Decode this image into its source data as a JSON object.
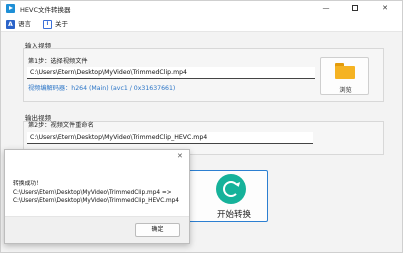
{
  "window": {
    "title": "HEVC文件转换器",
    "minimize": "—",
    "close": "✕"
  },
  "menu": {
    "language_label": "语言",
    "language_icon_text": "A",
    "about_label": "关于",
    "about_icon_text": "i"
  },
  "input_section": {
    "title": "输入视频",
    "step_label": "第1步：选择视频文件",
    "path": "C:\\Users\\Etern\\Desktop\\MyVideo\\TrimmedClip.mp4",
    "codec_info": "视频编解码器：h264 (Main) (avc1 / 0x31637661)",
    "browse_label": "浏览"
  },
  "output_section": {
    "title": "输出视频",
    "step_label": "第2步：视频文件重命名",
    "path": "C:\\Users\\Etern\\Desktop\\MyVideo\\TrimmedClip_HEVC.mp4"
  },
  "convert": {
    "label": "开始转换"
  },
  "dialog": {
    "close": "✕",
    "message": "转换成功！\nC:\\Users\\Etern\\Desktop\\MyVideo\\TrimmedClip.mp4 =>\nC:\\Users\\Etern\\Desktop\\MyVideo\\TrimmedClip_HEVC.mp4",
    "ok_label": "确定"
  },
  "colors": {
    "accent": "#2c7fd1",
    "codec_link": "#2b75c7",
    "folder": "#f5b323",
    "convert_icon": "#16b29a"
  }
}
